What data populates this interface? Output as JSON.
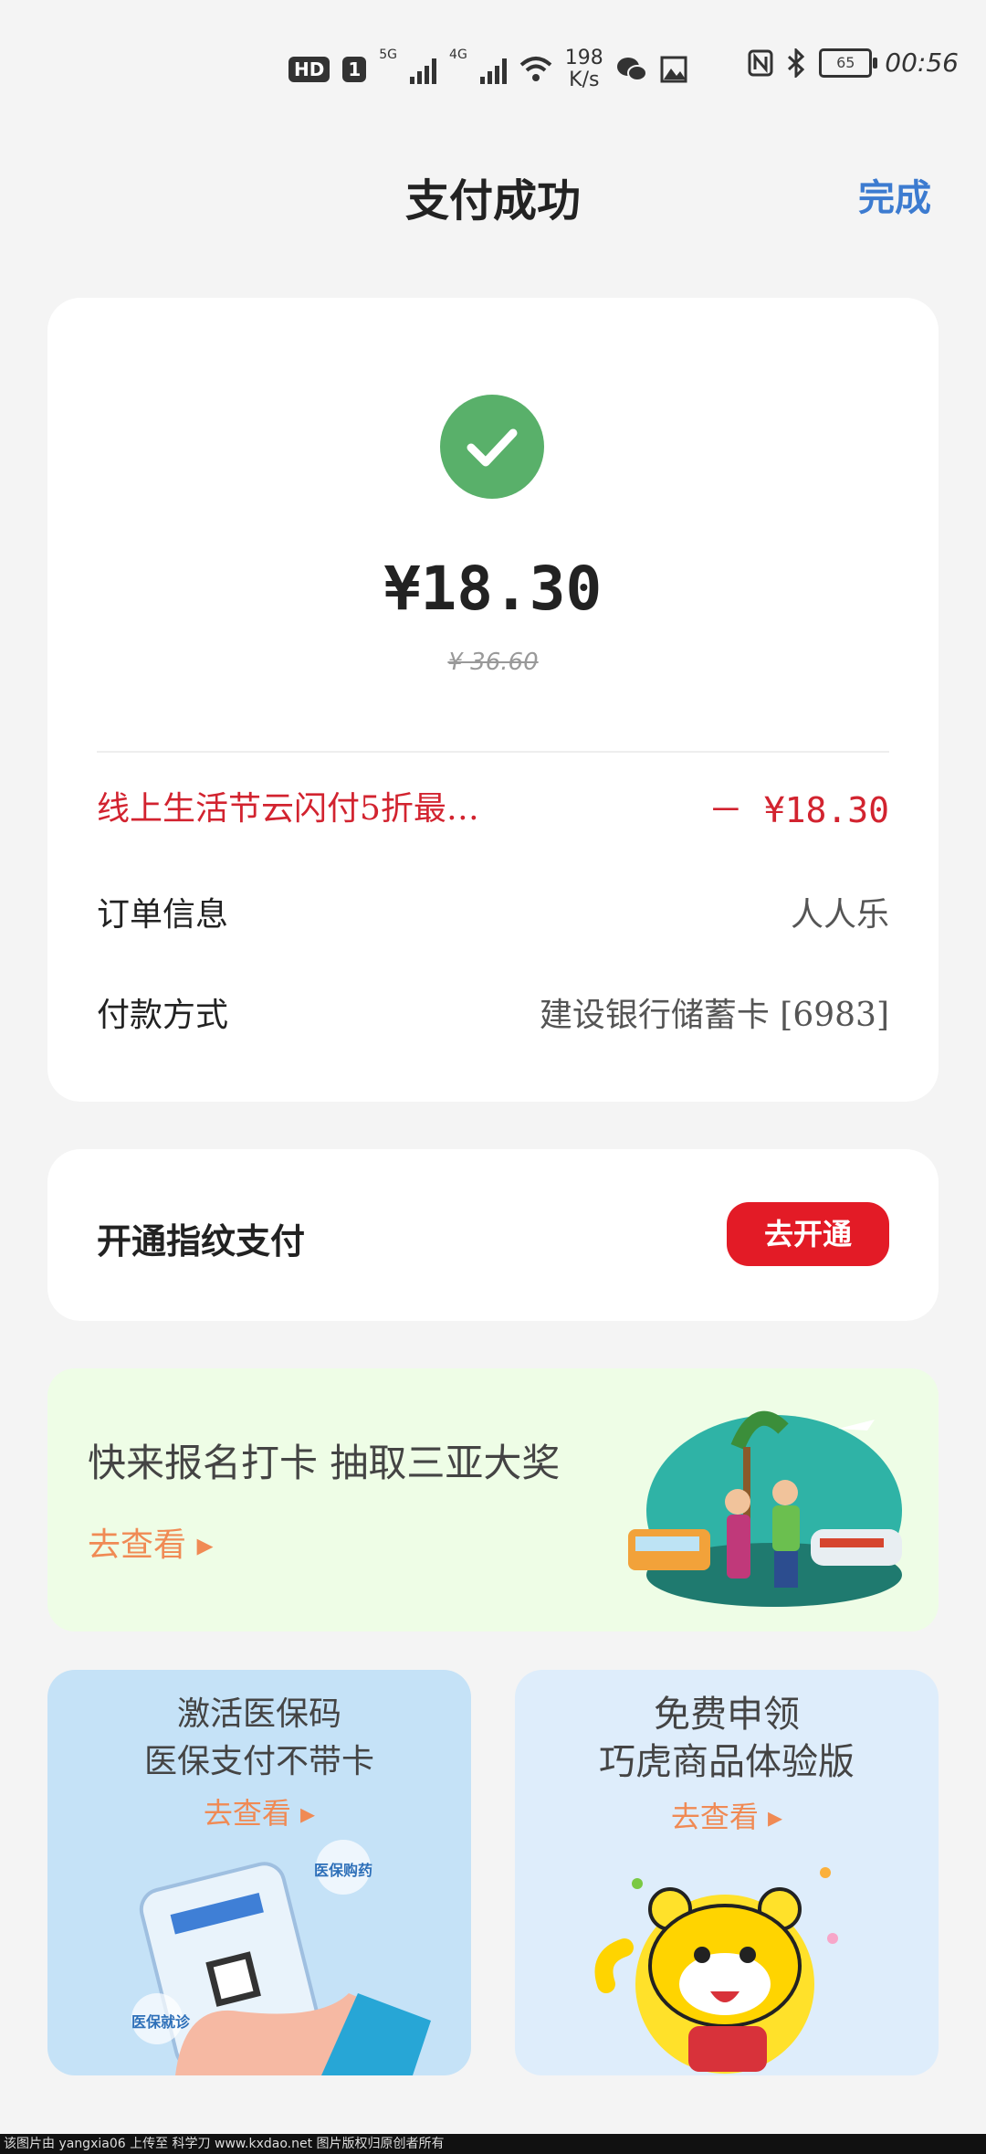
{
  "status_bar": {
    "network_badge": "HD",
    "sim": "1",
    "net1": "5G",
    "net2": "4G",
    "speed_value": "198",
    "speed_unit": "K/s",
    "battery": "65",
    "time": "00:56"
  },
  "header": {
    "title": "支付成功",
    "done_label": "完成"
  },
  "payment": {
    "amount": "¥18.30",
    "original_amount": "¥ 36.60",
    "discount": {
      "label": "线上生活节云闪付5折最…",
      "value": "－ ¥18.30"
    },
    "order": {
      "label": "订单信息",
      "value": "人人乐"
    },
    "method": {
      "label": "付款方式",
      "value": "建设银行储蓄卡 [6983]"
    }
  },
  "fingerprint": {
    "label": "开通指纹支付",
    "button": "去开通"
  },
  "banner": {
    "title": "快来报名打卡  抽取三亚大奖",
    "link": "去查看 ▸"
  },
  "tiles": {
    "left": {
      "line1": "激活医保码",
      "line2": "医保支付不带卡",
      "link": "去查看 ▸",
      "bubble1": "医保购药",
      "bubble2": "医保就诊"
    },
    "right": {
      "line1": "免费申领",
      "line2": "巧虎商品体验版",
      "link": "去查看 ▸"
    }
  },
  "watermark": "该图片由 yangxia06 上传至 科学刀 www.kxdao.net 图片版权归原创者所有",
  "colors": {
    "accent_blue": "#3c7bd0",
    "success_green": "#59b06a",
    "discount_red": "#d2232f",
    "button_red": "#e31b26",
    "link_orange": "#f08a54"
  }
}
